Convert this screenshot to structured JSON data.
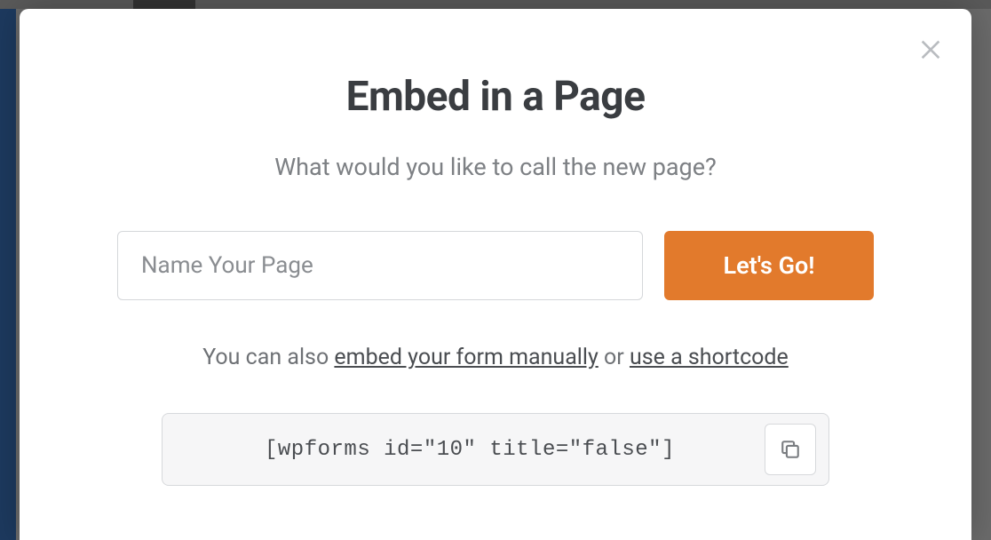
{
  "modal": {
    "title": "Embed in a Page",
    "subtitle": "What would you like to call the new page?",
    "page_name_placeholder": "Name Your Page",
    "go_button_label": "Let's Go!",
    "helper_prefix": "You can also ",
    "helper_link_manual": "embed your form manually",
    "helper_mid": " or ",
    "helper_link_shortcode": "use a shortcode",
    "shortcode_value": "[wpforms id=\"10\" title=\"false\"]"
  }
}
